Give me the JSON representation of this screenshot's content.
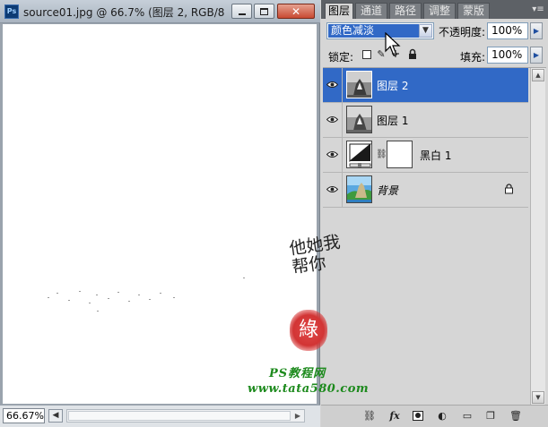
{
  "document": {
    "title": "source01.jpg @ 66.7% (图层 2, RGB/8...",
    "app_icon_label": "Ps",
    "zoom": "66.67%",
    "status_arrow": "◀"
  },
  "panel": {
    "tabs": [
      {
        "label": "图层",
        "active": true
      },
      {
        "label": "通道",
        "active": false
      },
      {
        "label": "路径",
        "active": false
      },
      {
        "label": "调整",
        "active": false
      },
      {
        "label": "蒙版",
        "active": false
      }
    ],
    "blend_mode": "颜色减淡",
    "opacity_label": "不透明度:",
    "opacity_value": "100%",
    "lock_label": "锁定:",
    "fill_label": "填充:",
    "fill_value": "100%",
    "layers": [
      {
        "name": "图层 2",
        "selected": true,
        "visible": true,
        "thumbnail": "grayscale-photo"
      },
      {
        "name": "图层 1",
        "selected": false,
        "visible": true,
        "thumbnail": "grayscale-photo"
      },
      {
        "name": "黑白 1",
        "selected": false,
        "visible": true,
        "thumbnail": "adjustment-black-white",
        "has_mask": true
      },
      {
        "name": "背景",
        "selected": false,
        "visible": true,
        "thumbnail": "color-photo",
        "locked": true
      }
    ]
  },
  "watermark": {
    "calligraphy": "他她我帮你",
    "seal": "綠",
    "site_name": "PS教程网",
    "url": "www.tata580.com"
  },
  "colors": {
    "selection": "#3169c6",
    "panel_bg": "#d6d6d6",
    "close_button": "#c84a32",
    "watermark_green": "#1d8a1d",
    "seal_red": "#d23434"
  }
}
